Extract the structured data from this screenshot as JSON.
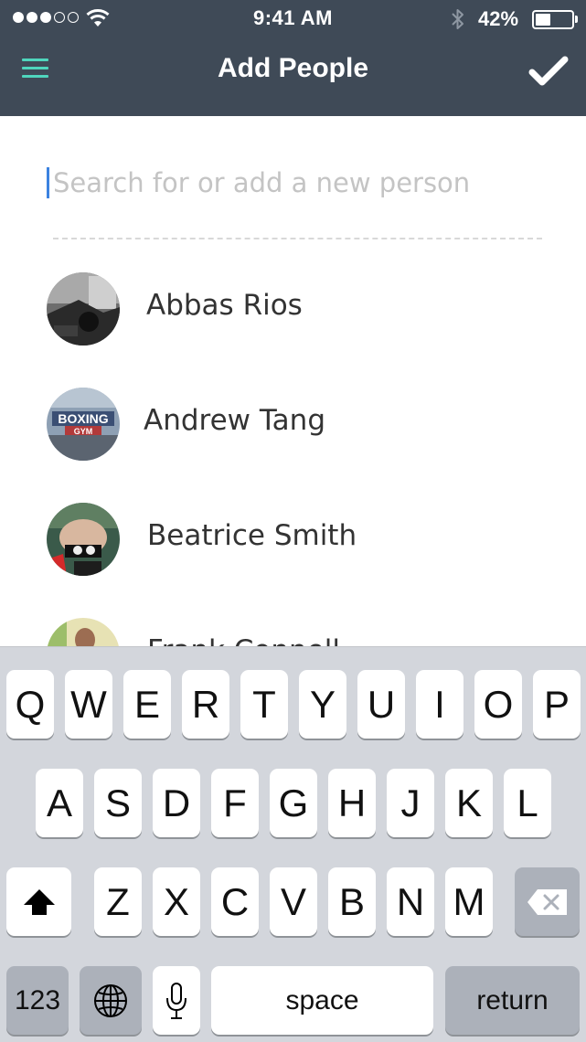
{
  "status_bar": {
    "time": "9:41 AM",
    "battery_percent": "42%",
    "battery_level": 0.42,
    "signal_bars_filled": 3,
    "signal_bars_total": 5
  },
  "header": {
    "title": "Add People",
    "background_color": "#3f4a57",
    "accent_color": "#4fd6bd",
    "menu_icon": "hamburger-menu-icon",
    "confirm_icon": "checkmark-icon"
  },
  "search": {
    "placeholder": "Search for or add a new person",
    "value": ""
  },
  "people": [
    {
      "name": "Abbas Rios"
    },
    {
      "name": "Andrew Tang",
      "avatar_text_1": "BOXING",
      "avatar_text_2": "GYM"
    },
    {
      "name": "Beatrice Smith"
    },
    {
      "name": "Frank Connell"
    }
  ],
  "keyboard": {
    "row1": [
      "Q",
      "W",
      "E",
      "R",
      "T",
      "Y",
      "U",
      "I",
      "O",
      "P"
    ],
    "row2": [
      "A",
      "S",
      "D",
      "F",
      "G",
      "H",
      "J",
      "K",
      "L"
    ],
    "row3": [
      "Z",
      "X",
      "C",
      "V",
      "B",
      "N",
      "M"
    ],
    "numbers_label": "123",
    "space_label": "space",
    "return_label": "return",
    "shift_icon": "shift-icon",
    "delete_icon": "delete-icon",
    "globe_icon": "globe-icon",
    "mic_icon": "microphone-icon"
  }
}
